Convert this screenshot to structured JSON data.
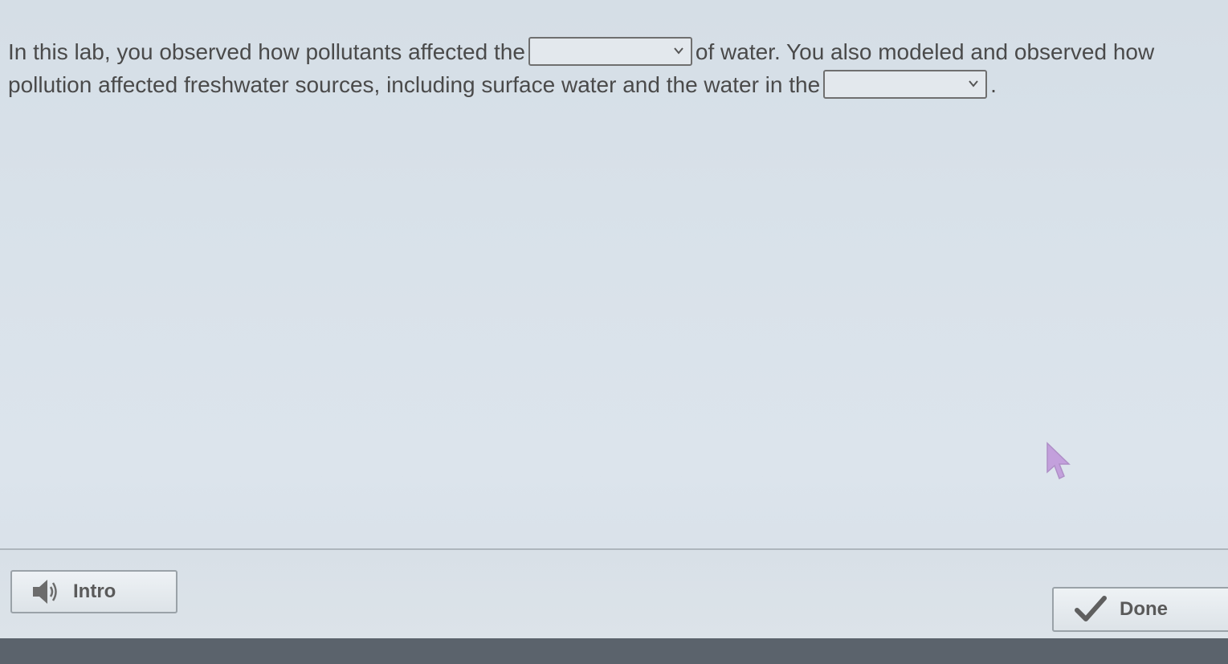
{
  "question": {
    "line1_before": "In this lab, you observed how pollutants affected the",
    "line1_after": "of water. You also modeled and observed how",
    "line2_before": "pollution affected freshwater sources, including surface water and the water in the",
    "line2_after": ".",
    "dropdown1": {
      "selected": ""
    },
    "dropdown2": {
      "selected": ""
    }
  },
  "footer": {
    "intro_label": "Intro",
    "done_label": "Done"
  },
  "icons": {
    "intro": "speaker-icon",
    "done": "checkmark-icon",
    "dropdown": "chevron-down-icon",
    "cursor": "mouse-pointer-icon"
  }
}
